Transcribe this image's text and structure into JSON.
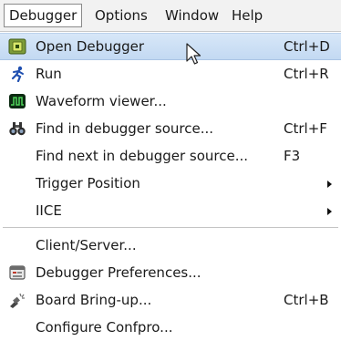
{
  "menubar": {
    "items": [
      {
        "label": "Debugger",
        "active": true
      },
      {
        "label": "Options",
        "active": false
      },
      {
        "label": "Window",
        "active": false
      },
      {
        "label": "Help",
        "active": false
      }
    ]
  },
  "menu": {
    "items": [
      {
        "label": "Open Debugger",
        "shortcut": "Ctrl+D",
        "icon": "open-debugger-icon",
        "highlighted": true
      },
      {
        "label": "Run",
        "shortcut": "Ctrl+R",
        "icon": "run-icon"
      },
      {
        "label": "Waveform viewer...",
        "shortcut": "",
        "icon": "waveform-viewer-icon"
      },
      {
        "label": "Find in debugger source...",
        "shortcut": "Ctrl+F",
        "icon": "binoculars-icon"
      },
      {
        "label": "Find next in debugger source...",
        "shortcut": "F3",
        "icon": ""
      },
      {
        "label": "Trigger Position",
        "shortcut": "",
        "icon": "",
        "submenu": true
      },
      {
        "label": "IICE",
        "shortcut": "",
        "icon": "",
        "submenu": true
      },
      {
        "label": "Client/Server...",
        "shortcut": "",
        "icon": ""
      },
      {
        "label": "Debugger Preferences...",
        "shortcut": "",
        "icon": "preferences-icon"
      },
      {
        "label": "Board Bring-up...",
        "shortcut": "Ctrl+B",
        "icon": "board-bringup-icon"
      },
      {
        "label": "Configure Confpro...",
        "shortcut": "",
        "icon": ""
      }
    ]
  },
  "colors": {
    "highlight": "#c8dcf3",
    "menubar_bg": "#f2f2f2",
    "run_icon": "#1f4fb0",
    "waveform_icon": "#1e6b2a"
  }
}
